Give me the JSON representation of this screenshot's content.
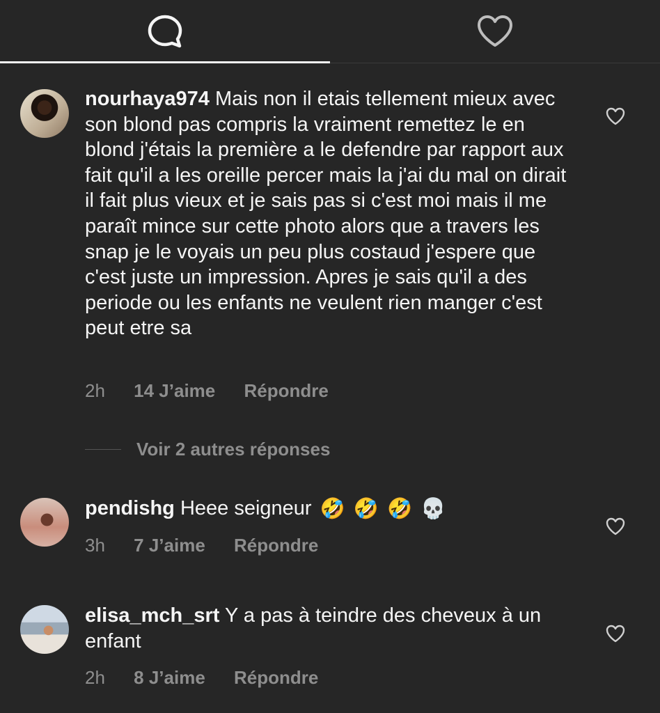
{
  "tabs": [
    {
      "name": "comments",
      "icon": "comment-bubble-icon",
      "active": true
    },
    {
      "name": "likes",
      "icon": "heart-icon",
      "active": false
    }
  ],
  "comments": [
    {
      "username": "nourhaya974",
      "text": "Mais non il etais tellement mieux avec son blond pas compris la vraiment remettez le en blond j'étais la première a le defendre par rapport aux fait qu'il a les oreille percer mais la j'ai du mal on dirait il fait plus vieux et je sais pas si c'est moi mais il me paraît mince sur cette photo alors que a travers les snap je le voyais un peu plus costaud j'espere que c'est juste un impression. Apres je sais qu'il a des periode ou les enfants ne veulent rien manger c'est peut etre sa",
      "time": "2h",
      "likes": "14 J’aime",
      "reply": "Répondre",
      "view_replies": "Voir 2 autres réponses"
    },
    {
      "username": "pendishg",
      "text": "Heee seigneur",
      "emojis": [
        "🤣",
        "🤣",
        "🤣",
        "💀"
      ],
      "time": "3h",
      "likes": "7 J’aime",
      "reply": "Répondre"
    },
    {
      "username": "elisa_mch_srt",
      "text": "Y a pas à teindre des cheveux à un enfant",
      "time": "2h",
      "likes": "8 J’aime",
      "reply": "Répondre"
    }
  ],
  "colors": {
    "background": "#262626",
    "text": "#f5f5f5",
    "muted": "#8e8e8e"
  }
}
